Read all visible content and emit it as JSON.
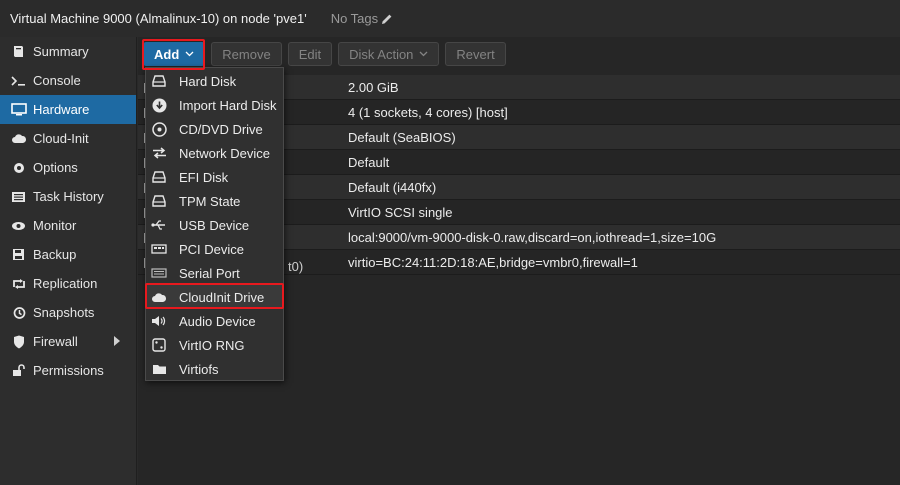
{
  "header": {
    "title": "Virtual Machine 9000 (Almalinux-10) on node 'pve1'",
    "tags": "No Tags"
  },
  "sidebar": {
    "items": [
      {
        "label": "Summary",
        "icon": "book-icon"
      },
      {
        "label": "Console",
        "icon": "terminal-icon"
      },
      {
        "label": "Hardware",
        "icon": "monitor-icon",
        "active": true
      },
      {
        "label": "Cloud-Init",
        "icon": "cloud-icon"
      },
      {
        "label": "Options",
        "icon": "gear-icon"
      },
      {
        "label": "Task History",
        "icon": "list-icon"
      },
      {
        "label": "Monitor",
        "icon": "eye-icon"
      },
      {
        "label": "Backup",
        "icon": "floppy-icon"
      },
      {
        "label": "Replication",
        "icon": "retweet-icon"
      },
      {
        "label": "Snapshots",
        "icon": "history-icon"
      },
      {
        "label": "Firewall",
        "icon": "shield-icon"
      },
      {
        "label": "Permissions",
        "icon": "unlock-icon"
      }
    ]
  },
  "toolbar": {
    "add": "Add",
    "remove": "Remove",
    "edit": "Edit",
    "disk_action": "Disk Action",
    "revert": "Revert"
  },
  "hardware": {
    "rows": [
      {
        "value": "2.00 GiB"
      },
      {
        "value": "4 (1 sockets, 4 cores) [host]"
      },
      {
        "value": "Default (SeaBIOS)"
      },
      {
        "value": "Default"
      },
      {
        "value": "Default (i440fx)"
      },
      {
        "value": "VirtIO SCSI single"
      },
      {
        "value": "local:9000/vm-9000-disk-0.raw,discard=on,iothread=1,size=10G"
      },
      {
        "value": "virtio=BC:24:11:2D:18:AE,bridge=vmbr0,firewall=1",
        "partial_key": "t0)"
      }
    ]
  },
  "add_menu": {
    "items": [
      {
        "label": "Hard Disk",
        "icon": "hdd-icon"
      },
      {
        "label": "Import Hard Disk",
        "icon": "download-icon"
      },
      {
        "label": "CD/DVD Drive",
        "icon": "disc-icon"
      },
      {
        "label": "Network Device",
        "icon": "exchange-icon"
      },
      {
        "label": "EFI Disk",
        "icon": "hdd-icon"
      },
      {
        "label": "TPM State",
        "icon": "hdd-icon"
      },
      {
        "label": "USB Device",
        "icon": "usb-icon"
      },
      {
        "label": "PCI Device",
        "icon": "pci-card-icon"
      },
      {
        "label": "Serial Port",
        "icon": "keyboard-icon"
      },
      {
        "label": "CloudInit Drive",
        "icon": "cloud-icon"
      },
      {
        "label": "Audio Device",
        "icon": "speaker-icon"
      },
      {
        "label": "VirtIO RNG",
        "icon": "dice-icon"
      },
      {
        "label": "Virtiofs",
        "icon": "folder-icon"
      }
    ]
  },
  "colors": {
    "accent": "#1e6aa3",
    "highlight": "#e8191e"
  }
}
